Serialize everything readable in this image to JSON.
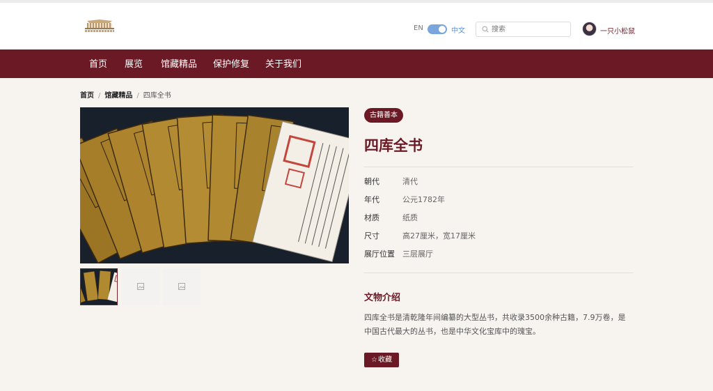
{
  "header": {
    "lang_en": "EN",
    "lang_zh": "中文",
    "search_placeholder": "搜索",
    "username": "一只小松鼠"
  },
  "nav": {
    "items": [
      {
        "label": "首页"
      },
      {
        "label": "展览"
      },
      {
        "label": "馆藏精品"
      },
      {
        "label": "保护修复"
      },
      {
        "label": "关于我们"
      }
    ]
  },
  "breadcrumb": {
    "home": "首页",
    "collection": "馆藏精品",
    "current": "四库全书"
  },
  "artifact": {
    "category": "古籍善本",
    "title": "四库全书",
    "attributes": [
      {
        "label": "朝代",
        "value": "清代"
      },
      {
        "label": "年代",
        "value": "公元1782年"
      },
      {
        "label": "材质",
        "value": "纸质"
      },
      {
        "label": "尺寸",
        "value": "高27厘米，宽17厘米"
      },
      {
        "label": "展厅位置",
        "value": "三层展厅"
      }
    ],
    "intro_title": "文物介绍",
    "intro_text": "四库全书是清乾隆年间编纂的大型丛书，共收录3500余种古籍，7.9万卷，是中国古代最大的丛书，也是中华文化宝库中的瑰宝。",
    "favorite_label": "收藏"
  },
  "icons": {
    "favorite": "star-icon",
    "search": "search-icon",
    "thumbnail_placeholder": "image-placeholder-icon"
  },
  "colors": {
    "brand": "#6b1a25",
    "background": "#f7f3ef",
    "toggle": "#7aa6dd"
  }
}
